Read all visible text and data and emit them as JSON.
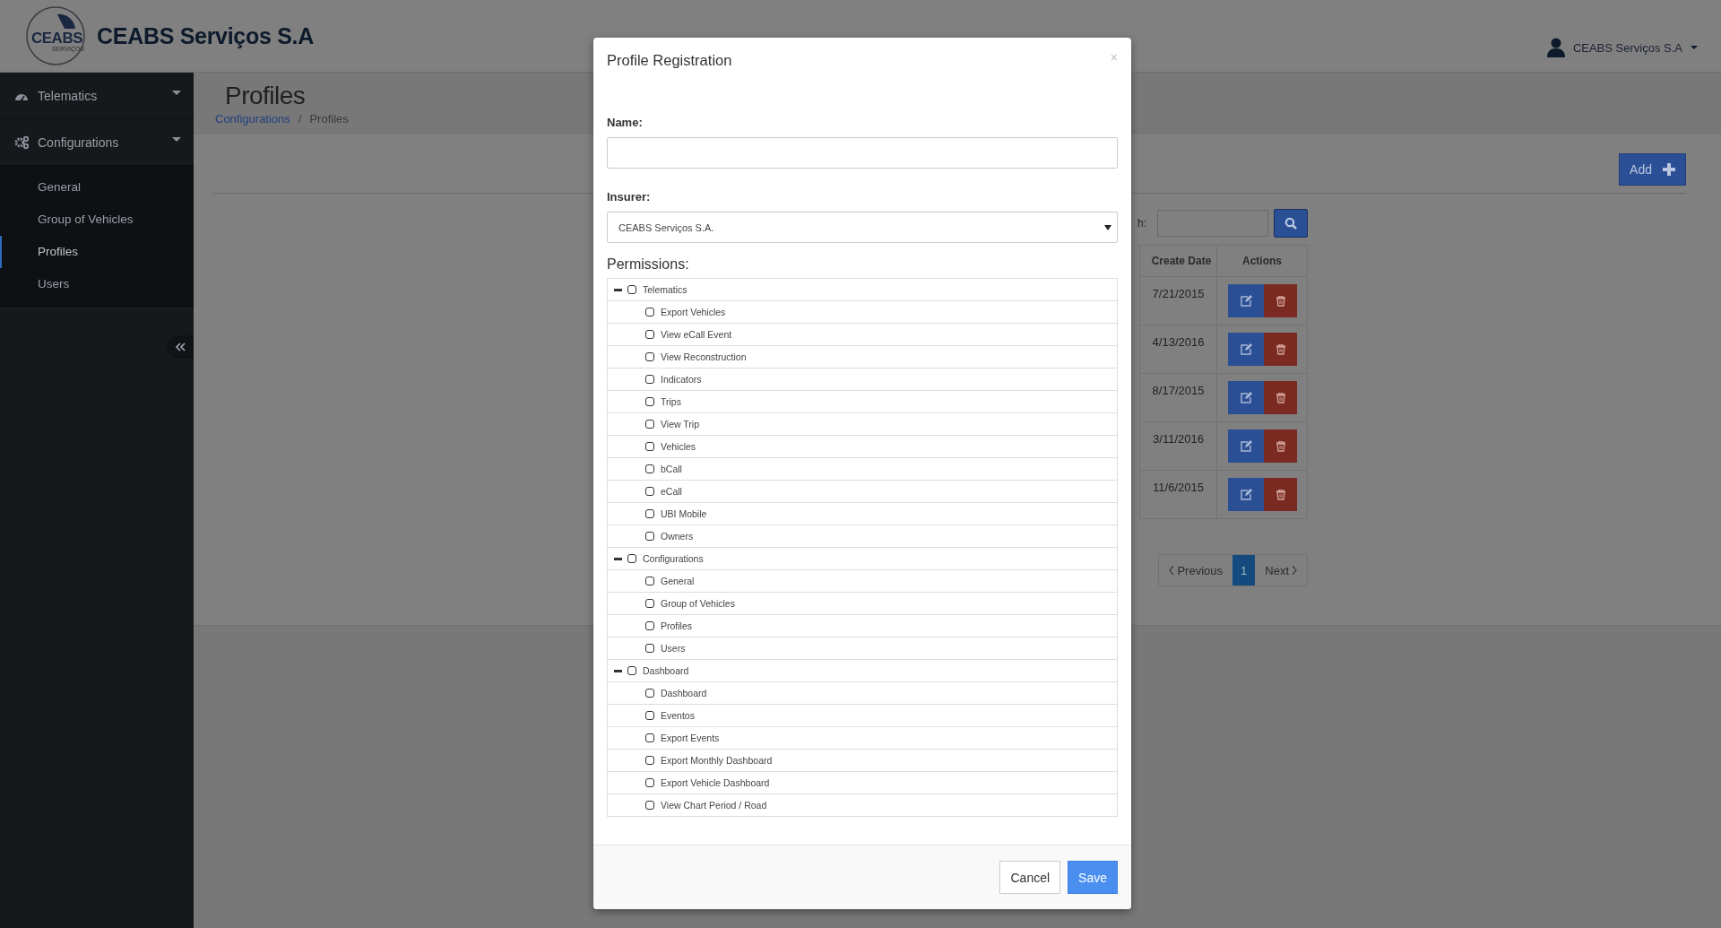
{
  "header": {
    "logo": {
      "text": "CEABS",
      "subtext": "SERVIÇOS"
    },
    "brand": "CEABS Serviços S.A",
    "user": "CEABS Serviços S.A"
  },
  "sidebar": {
    "items": [
      {
        "label": "Telematics"
      },
      {
        "label": "Configurations",
        "children": [
          {
            "label": "General",
            "selected": false
          },
          {
            "label": "Group of Vehicles",
            "selected": false
          },
          {
            "label": "Profiles",
            "selected": true
          },
          {
            "label": "Users",
            "selected": false
          }
        ]
      }
    ]
  },
  "page": {
    "title": "Profiles",
    "breadcrumb": [
      "Configurations",
      "/",
      "Profiles"
    ],
    "add_button": "Add",
    "search_label": "h:",
    "table": {
      "columns": [
        "Create Date",
        "Actions"
      ],
      "rows": [
        {
          "create_date": "7/21/2015"
        },
        {
          "create_date": "4/13/2016"
        },
        {
          "create_date": "8/17/2015"
        },
        {
          "create_date": "3/11/2016"
        },
        {
          "create_date": "11/6/2015"
        }
      ]
    },
    "pagination": {
      "previous": "Previous",
      "pages": [
        {
          "label": "1",
          "selected": true
        }
      ],
      "next": "Next"
    }
  },
  "modal": {
    "title": "Profile Registration",
    "close": "×",
    "name_label": "Name:",
    "insurer_label": "Insurer:",
    "insurer_value": "CEABS Serviços S.A.",
    "permissions_label": "Permissions:",
    "permissions": [
      {
        "label": "Telematics",
        "checked": false,
        "expanded": true,
        "children": [
          {
            "label": "Export Vehicles",
            "checked": false
          },
          {
            "label": "View eCall Event",
            "checked": false
          },
          {
            "label": "View Reconstruction",
            "checked": false
          },
          {
            "label": "Indicators",
            "checked": false
          },
          {
            "label": "Trips",
            "checked": false
          },
          {
            "label": "View Trip",
            "checked": false
          },
          {
            "label": "Vehicles",
            "checked": false
          },
          {
            "label": "bCall",
            "checked": false
          },
          {
            "label": "eCall",
            "checked": false
          },
          {
            "label": "UBI Mobile",
            "checked": false
          },
          {
            "label": "Owners",
            "checked": false
          }
        ]
      },
      {
        "label": "Configurations",
        "checked": false,
        "expanded": true,
        "children": [
          {
            "label": "General",
            "checked": false
          },
          {
            "label": "Group of Vehicles",
            "checked": false
          },
          {
            "label": "Profiles",
            "checked": false
          },
          {
            "label": "Users",
            "checked": false
          }
        ]
      },
      {
        "label": "Dashboard",
        "checked": false,
        "expanded": true,
        "children": [
          {
            "label": "Dashboard",
            "checked": false
          },
          {
            "label": "Eventos",
            "checked": false
          },
          {
            "label": "Export Events",
            "checked": false
          },
          {
            "label": "Export Monthly Dashboard",
            "checked": false
          },
          {
            "label": "Export Vehicle Dashboard",
            "checked": false
          },
          {
            "label": "View Chart Period / Road",
            "checked": false
          }
        ]
      }
    ],
    "buttons": [
      {
        "label": "Cancel",
        "kind": "default"
      },
      {
        "label": "Save",
        "kind": "primary"
      }
    ]
  }
}
